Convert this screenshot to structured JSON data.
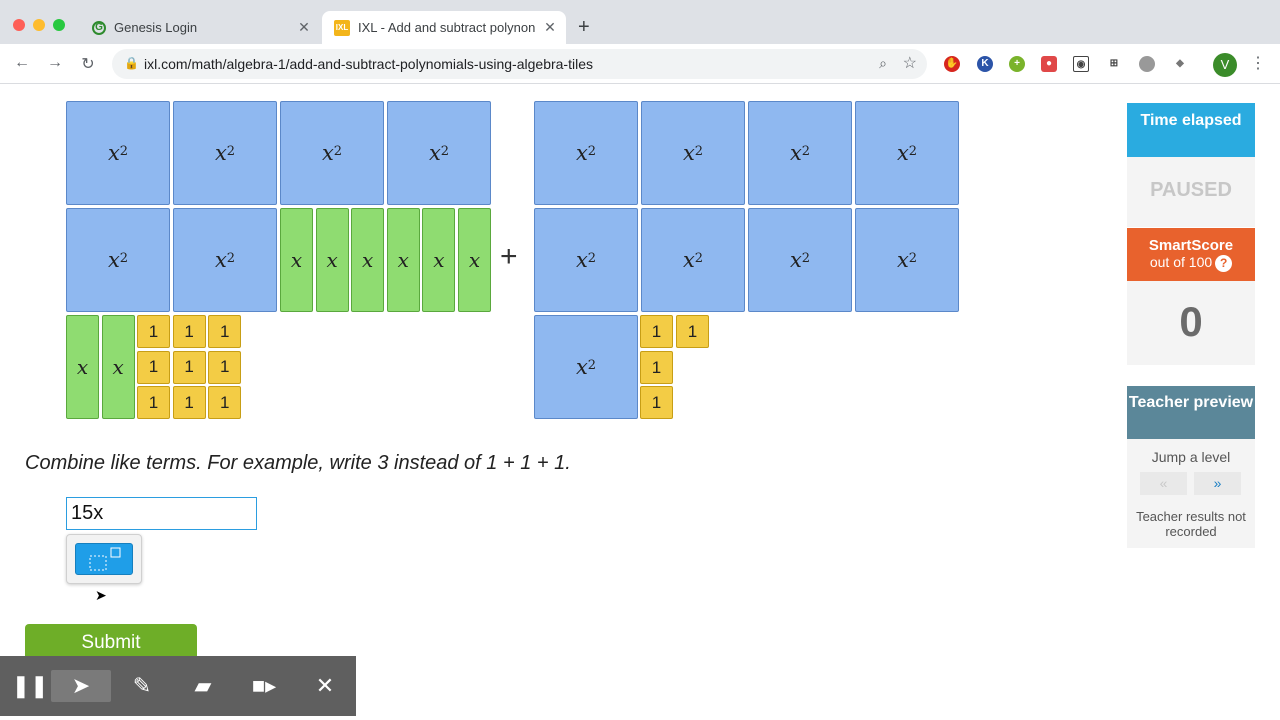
{
  "browser": {
    "tabs": [
      {
        "title": "Genesis Login",
        "close": "✕",
        "active": false
      },
      {
        "title": "IXL - Add and subtract polynon",
        "close": "✕",
        "active": true
      }
    ],
    "new_tab": "+",
    "url": "ixl.com/math/algebra-1/add-and-subtract-polynomials-using-algebra-tiles",
    "profile_initial": "V",
    "menu": "⋮"
  },
  "tiles": {
    "x2_label": "x",
    "x2_exp": "2",
    "x_label": "x",
    "one_label": "1"
  },
  "plus_sign": "+",
  "instruction": "Combine like terms. For example, write 3 instead of 1 + 1 + 1.",
  "answer_value": "15x",
  "submit_label": "Submit",
  "sidebar": {
    "time_title": "Time elapsed",
    "time_value": "PAUSED",
    "score_title": "SmartScore",
    "score_sub": "out of 100",
    "score_help": "?",
    "score_value": "0",
    "teacher_title": "Teacher preview",
    "jump_label": "Jump a level",
    "jump_back": "«",
    "jump_forward": "»",
    "teacher_note": "Teacher results not recorded"
  },
  "colors": {
    "x2_tile": "#8fb8f0",
    "x_tile": "#8fdc71",
    "one_tile": "#f3cc45",
    "time_header": "#2aabe0",
    "score_header": "#e8622d",
    "teacher_header": "#5b8799",
    "submit": "#6eae28"
  }
}
